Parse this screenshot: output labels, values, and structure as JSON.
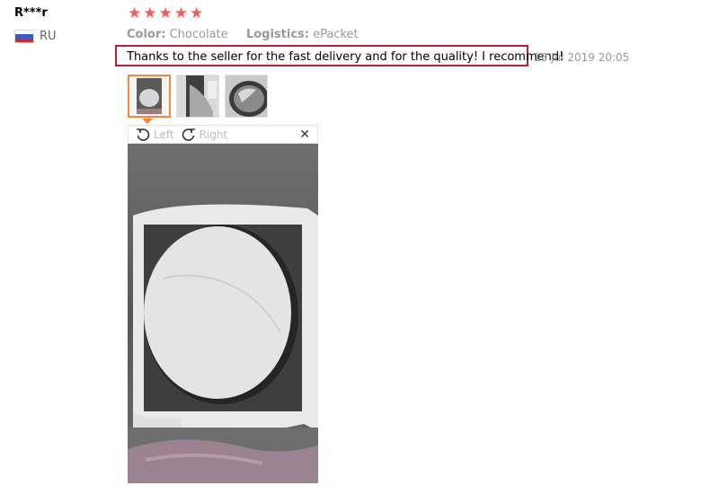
{
  "reviewer": {
    "name": "R***r",
    "country": "RU"
  },
  "rating": {
    "stars": 5,
    "max": 5
  },
  "attributes": {
    "color_label": "Color:",
    "color_value": "Chocolate",
    "logistics_label": "Logistics:",
    "logistics_value": "ePacket"
  },
  "feedback": {
    "text": "Thanks to the seller for the fast delivery and for the quality! I recommend!",
    "date": "18 Jul 2019 20:05"
  },
  "viewer": {
    "rotate_left_label": "Left",
    "rotate_right_label": "Right",
    "close_glyph": "✕"
  },
  "icons": {
    "star": "star-icon",
    "flag": "russia-flag-icon",
    "rotate_left": "rotate-left-icon",
    "rotate_right": "rotate-right-icon",
    "close": "close-icon"
  },
  "colors": {
    "star": "#f25c54",
    "highlight_border": "#c0202a",
    "active_thumb": "#f08a3c"
  }
}
